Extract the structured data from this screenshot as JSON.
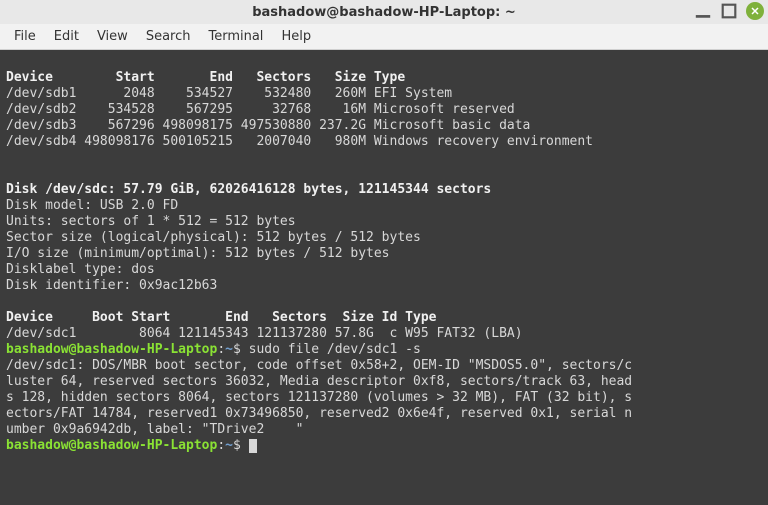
{
  "titlebar": {
    "title": "bashadow@bashadow-HP-Laptop: ~"
  },
  "menu": {
    "file": "File",
    "edit": "Edit",
    "view": "View",
    "search": "Search",
    "terminal": "Terminal",
    "help": "Help"
  },
  "out": {
    "hdr1": "Device        Start       End   Sectors   Size Type",
    "r1": "/dev/sdb1      2048    534527    532480   260M EFI System",
    "r2": "/dev/sdb2    534528    567295     32768    16M Microsoft reserved",
    "r3": "/dev/sdb3    567296 498098175 497530880 237.2G Microsoft basic data",
    "r4": "/dev/sdb4 498098176 500105215   2007040   980M Windows recovery environment",
    "blank": "",
    "disk2a": "Disk /dev/sdc: 57.79 GiB, 62026416128 bytes, 121145344 sectors",
    "disk2b": "Disk model: USB 2.0 FD      ",
    "disk2c": "Units: sectors of 1 * 512 = 512 bytes",
    "disk2d": "Sector size (logical/physical): 512 bytes / 512 bytes",
    "disk2e": "I/O size (minimum/optimal): 512 bytes / 512 bytes",
    "disk2f": "Disklabel type: dos",
    "disk2g": "Disk identifier: 0x9ac12b63",
    "hdr2": "Device     Boot Start       End   Sectors  Size Id Type",
    "r5": "/dev/sdc1        8064 121145343 121137280 57.8G  c W95 FAT32 (LBA)",
    "prompt_user": "bashadow@bashadow-HP-Laptop",
    "prompt_colon": ":",
    "prompt_path": "~",
    "prompt_dollar": "$ ",
    "cmd1": "sudo file /dev/sdc1 -s",
    "file1": "/dev/sdc1: DOS/MBR boot sector, code offset 0x58+2, OEM-ID \"MSDOS5.0\", sectors/c",
    "file2": "luster 64, reserved sectors 36032, Media descriptor 0xf8, sectors/track 63, head",
    "file3": "s 128, hidden sectors 8064, sectors 121137280 (volumes > 32 MB), FAT (32 bit), s",
    "file4": "ectors/FAT 14784, reserved1 0x73496850, reserved2 0x6e4f, reserved 0x1, serial n",
    "file5": "umber 0x9a6942db, label: \"TDrive2    \""
  }
}
